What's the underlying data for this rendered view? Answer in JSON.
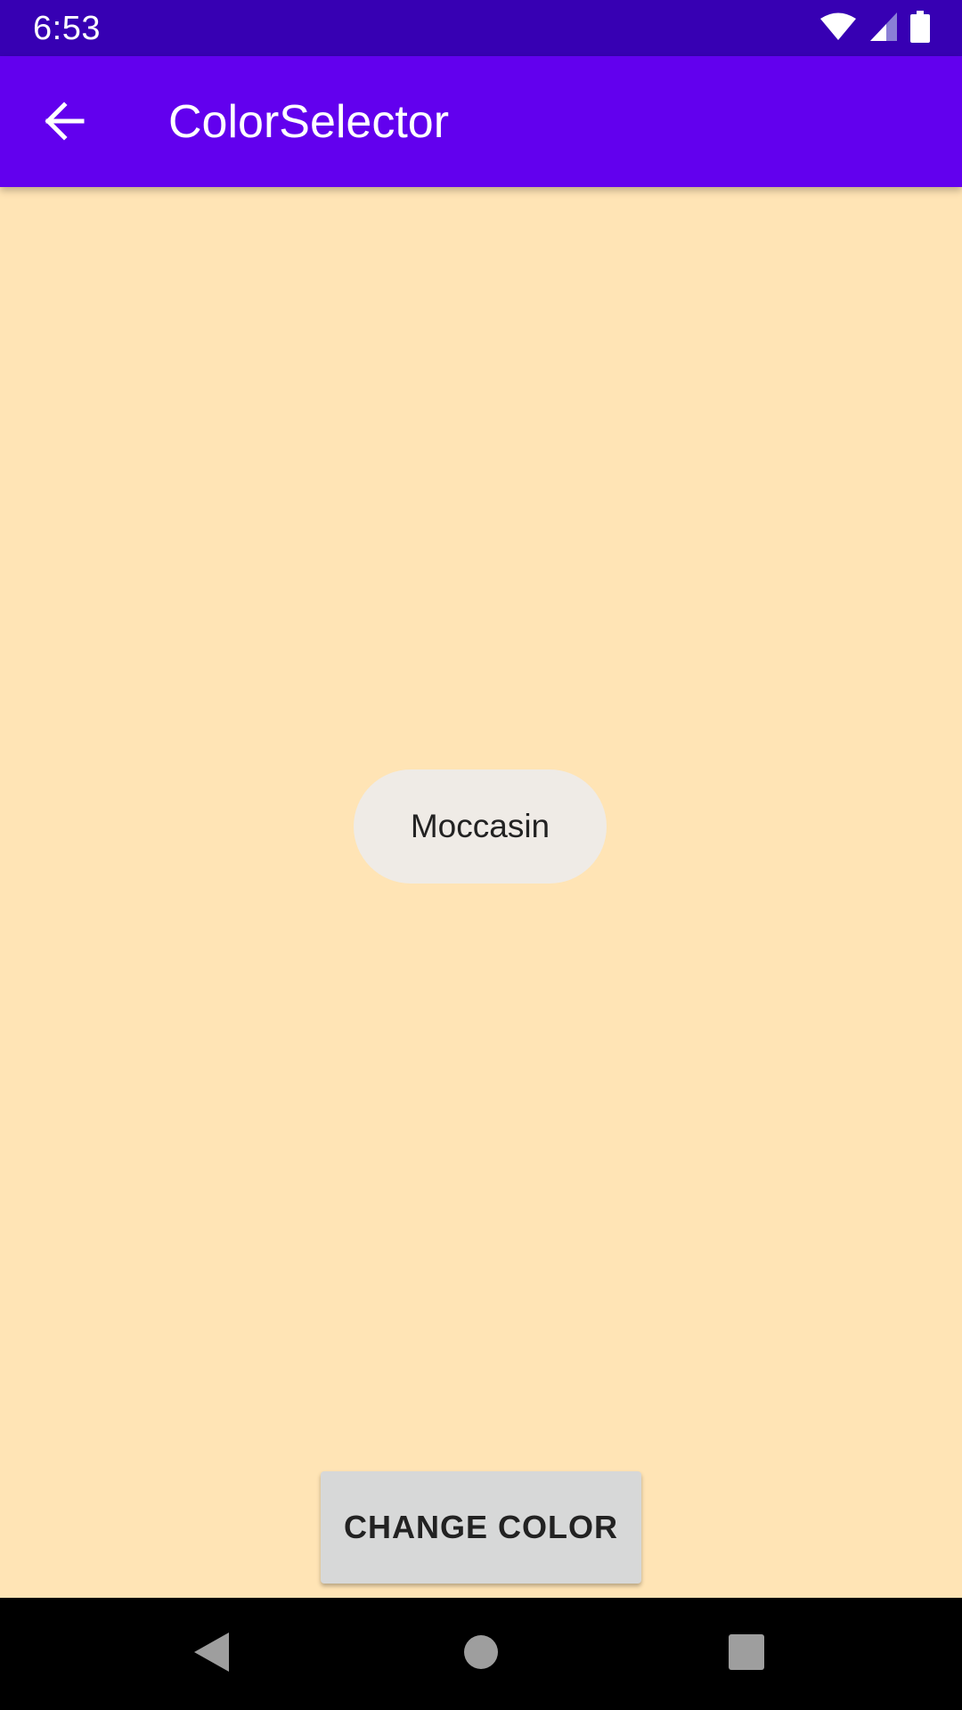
{
  "status_bar": {
    "time": "6:53",
    "icons": [
      "wifi-icon",
      "cell-signal-icon",
      "battery-icon"
    ]
  },
  "app_bar": {
    "title": "ColorSelector",
    "back_icon": "arrow-left-icon"
  },
  "content": {
    "background_color": "#FFE4B5",
    "color_name": "Moccasin",
    "button_label": "CHANGE COLOR"
  },
  "nav_bar": {
    "icons": [
      "back-triangle-icon",
      "home-circle-icon",
      "recents-square-icon"
    ]
  },
  "colors": {
    "status_bar": "#3700B3",
    "app_bar": "#6200EE",
    "chip": "#EFEBE6",
    "button": "#D7D8D8"
  }
}
